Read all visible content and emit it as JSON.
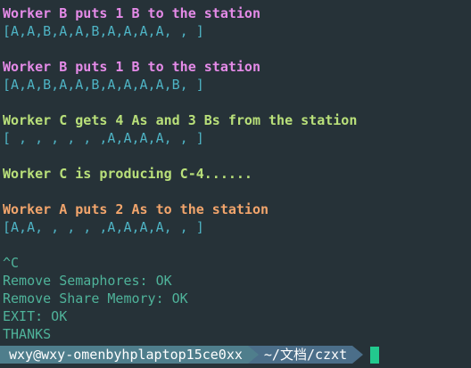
{
  "lines": [
    {
      "text": "Worker B puts 1 B to the station",
      "style": "magenta bold"
    },
    {
      "text": "[A,A,B,A,A,B,A,A,A,A, , ]",
      "style": "cyan"
    },
    {
      "text": "",
      "style": ""
    },
    {
      "text": "Worker B puts 1 B to the station",
      "style": "magenta bold"
    },
    {
      "text": "[A,A,B,A,A,B,A,A,A,A,B, ]",
      "style": "cyan"
    },
    {
      "text": "",
      "style": ""
    },
    {
      "text": "Worker C gets 4 As and 3 Bs from the station",
      "style": "green-b bold"
    },
    {
      "text": "[ , , , , , ,A,A,A,A, , ]",
      "style": "cyan"
    },
    {
      "text": "",
      "style": ""
    },
    {
      "text": "Worker C is producing C-4......",
      "style": "green-b bold"
    },
    {
      "text": "",
      "style": ""
    },
    {
      "text": "Worker A puts 2 As to the station",
      "style": "orange bold"
    },
    {
      "text": "[A,A, , , , ,A,A,A,A, , ]",
      "style": "cyan"
    },
    {
      "text": "",
      "style": ""
    },
    {
      "text": "^C",
      "style": "teal"
    },
    {
      "text": "Remove Semaphores: OK",
      "style": "teal"
    },
    {
      "text": "Remove Share Memory: OK",
      "style": "teal"
    },
    {
      "text": "EXIT: OK",
      "style": "teal"
    },
    {
      "text": "THANKS",
      "style": "teal"
    }
  ],
  "prompt": {
    "user_host": "wxy@wxy-omenbyhplaptop15ce0xx",
    "path": "~/文档/czxt"
  },
  "colors": {
    "background": "#263238",
    "cursor": "#22c98e"
  }
}
